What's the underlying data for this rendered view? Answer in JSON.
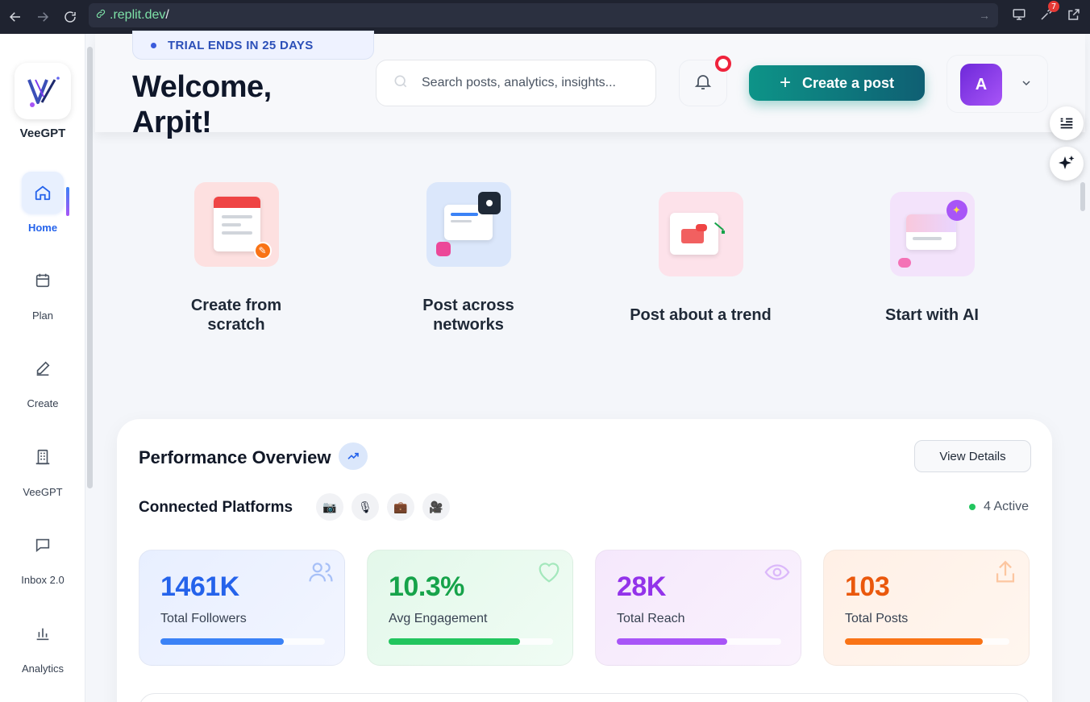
{
  "browser": {
    "url_host": ".replit.dev",
    "url_path": "/",
    "extension_badge": "7"
  },
  "sidebar": {
    "brand": "VeeGPT",
    "items": [
      {
        "label": "Home",
        "icon": "home-icon"
      },
      {
        "label": "Plan",
        "icon": "calendar-icon"
      },
      {
        "label": "Create",
        "icon": "pen-icon"
      },
      {
        "label": "VeeGPT",
        "icon": "building-icon"
      },
      {
        "label": "Inbox 2.0",
        "icon": "chat-icon"
      },
      {
        "label": "Analytics",
        "icon": "bar-chart-icon"
      }
    ]
  },
  "header": {
    "trial_text": "TRIAL ENDS IN 25 DAYS",
    "welcome_line1": "Welcome,",
    "welcome_line2": "Arpit!",
    "search_placeholder": "Search posts, analytics, insights...",
    "cta_label": "Create a post",
    "avatar_initial": "A"
  },
  "quick_actions": [
    {
      "line1": "Create from",
      "line2": "scratch"
    },
    {
      "line1": "Post across",
      "line2": "networks"
    },
    {
      "line1": "Post about a trend",
      "line2": ""
    },
    {
      "line1": "Start with AI",
      "line2": ""
    }
  ],
  "performance": {
    "title": "Performance Overview",
    "details_button": "View Details",
    "connected_title": "Connected Platforms",
    "platform_chips": [
      "📷",
      "🎙",
      "💼",
      "🎥"
    ],
    "active_text": "4 Active",
    "stats": [
      {
        "value": "1461K",
        "label": "Total Followers",
        "progress": 0.75,
        "color": "#2563eb",
        "bar": "#3b82f6"
      },
      {
        "value": "10.3%",
        "label": "Avg Engagement",
        "progress": 0.8,
        "color": "#16a34a",
        "bar": "#22c55e"
      },
      {
        "value": "28K",
        "label": "Total Reach",
        "progress": 0.67,
        "color": "#9333ea",
        "bar": "#a855f7"
      },
      {
        "value": "103",
        "label": "Total Posts",
        "progress": 0.84,
        "color": "#ea580c",
        "bar": "#f97316"
      }
    ]
  }
}
